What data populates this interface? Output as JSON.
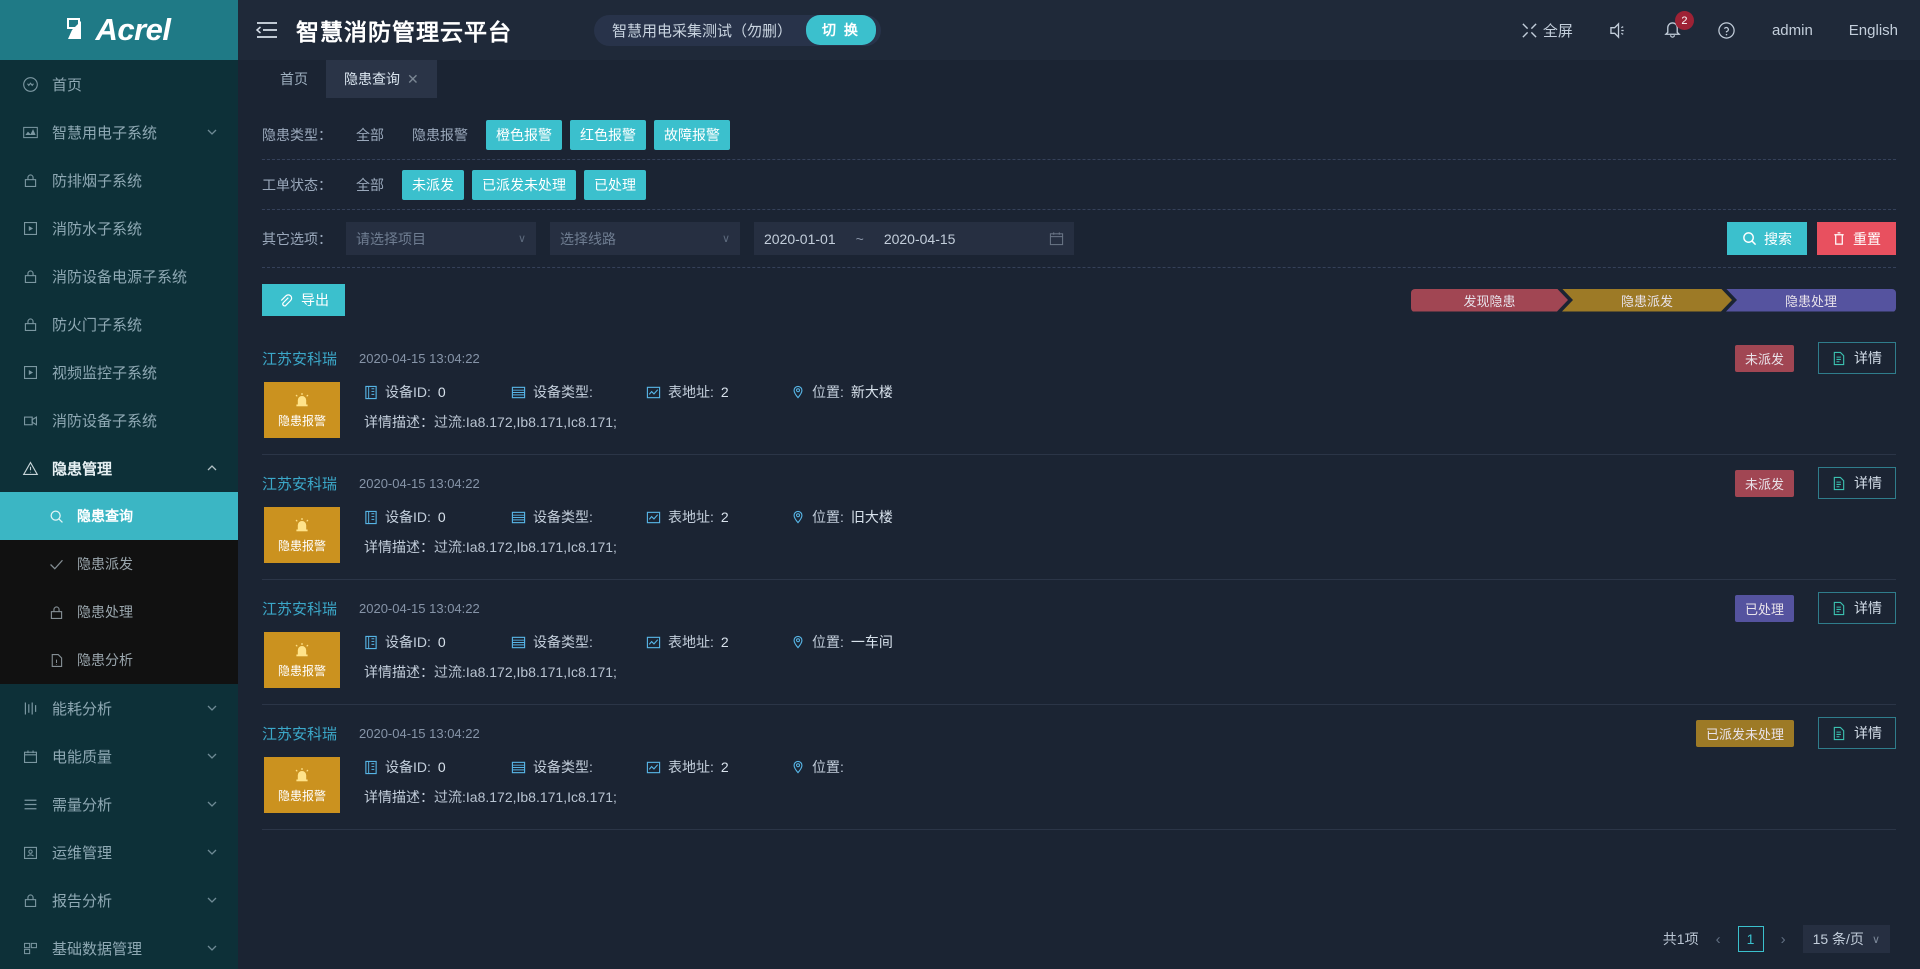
{
  "sidebar": {
    "logo_text": "Acrel",
    "items": [
      {
        "label": "首页",
        "icon": "smiley-icon",
        "has_children": false
      },
      {
        "label": "智慧用电子系统",
        "icon": "chart-bar-icon",
        "has_children": true
      },
      {
        "label": "防排烟子系统",
        "icon": "lock-icon",
        "has_children": false
      },
      {
        "label": "消防水子系统",
        "icon": "play-square-icon",
        "has_children": false
      },
      {
        "label": "消防设备电源子系统",
        "icon": "lock-icon",
        "has_children": false
      },
      {
        "label": "防火门子系统",
        "icon": "lock-icon",
        "has_children": false
      },
      {
        "label": "视频监控子系统",
        "icon": "play-square-icon",
        "has_children": false
      },
      {
        "label": "消防设备子系统",
        "icon": "camera-icon",
        "has_children": false
      },
      {
        "label": "隐患管理",
        "icon": "warning-triangle-icon",
        "has_children": true,
        "expanded": true
      }
    ],
    "sub_items": [
      {
        "label": "隐患查询",
        "icon": "search-icon",
        "active": true
      },
      {
        "label": "隐患派发",
        "icon": "check-icon",
        "active": false
      },
      {
        "label": "隐患处理",
        "icon": "lock-icon",
        "active": false
      },
      {
        "label": "隐患分析",
        "icon": "file-icon",
        "active": false
      }
    ],
    "items_after": [
      {
        "label": "能耗分析",
        "icon": "sliders-icon",
        "has_children": true
      },
      {
        "label": "电能质量",
        "icon": "calendar-icon",
        "has_children": true
      },
      {
        "label": "需量分析",
        "icon": "layers-icon",
        "has_children": true
      },
      {
        "label": "运维管理",
        "icon": "id-card-icon",
        "has_children": true
      },
      {
        "label": "报告分析",
        "icon": "lock-icon",
        "has_children": true
      },
      {
        "label": "基础数据管理",
        "icon": "grid-icon",
        "has_children": true
      }
    ]
  },
  "topbar": {
    "menu_toggle": "menu-fold-icon",
    "title": "智慧消防管理云平台",
    "project_name": "智慧用电采集测试（勿删）",
    "switch_label": "切 换",
    "fullscreen_label": "全屏",
    "notify_count": "2",
    "user": "admin",
    "language": "English"
  },
  "tabs": [
    {
      "label": "首页",
      "closable": false,
      "active": false
    },
    {
      "label": "隐患查询",
      "closable": true,
      "active": true
    }
  ],
  "filters": {
    "type_label": "隐患类型：",
    "type_options": [
      {
        "label": "全部",
        "selected": false
      },
      {
        "label": "隐患报警",
        "selected": false
      },
      {
        "label": "橙色报警",
        "selected": true
      },
      {
        "label": "红色报警",
        "selected": true
      },
      {
        "label": "故障报警",
        "selected": true
      }
    ],
    "status_label": "工单状态：",
    "status_options": [
      {
        "label": "全部",
        "selected": false
      },
      {
        "label": "未派发",
        "selected": true
      },
      {
        "label": "已派发未处理",
        "selected": true
      },
      {
        "label": "已处理",
        "selected": true
      }
    ],
    "other_label": "其它选项：",
    "project_placeholder": "请选择项目",
    "line_placeholder": "选择线路",
    "date_start": "2020-01-01",
    "date_sep": "~",
    "date_end": "2020-04-15",
    "search_label": "搜索",
    "reset_label": "重置"
  },
  "toolbar": {
    "export_label": "导出",
    "legend": [
      {
        "label": "发现隐患",
        "color": "#a14653"
      },
      {
        "label": "隐患派发",
        "color": "#9d7a26"
      },
      {
        "label": "隐患处理",
        "color": "#55539f"
      }
    ]
  },
  "record_labels": {
    "device_id": "设备ID:",
    "device_type": "设备类型:",
    "meter_addr": "表地址:",
    "location": "位置:",
    "description": "详情描述：",
    "detail_button": "详情",
    "alarm_chip": "隐患报警"
  },
  "records": [
    {
      "org": "江苏安科瑞",
      "time": "2020-04-15 13:04:22",
      "status": "未派发",
      "status_class": "s-undispatched",
      "alarm": "隐患报警",
      "device_id": "0",
      "device_type": "",
      "meter_addr": "2",
      "location": "新大楼",
      "description": "过流:Ia8.172,Ib8.171,Ic8.171;"
    },
    {
      "org": "江苏安科瑞",
      "time": "2020-04-15 13:04:22",
      "status": "未派发",
      "status_class": "s-undispatched",
      "alarm": "隐患报警",
      "device_id": "0",
      "device_type": "",
      "meter_addr": "2",
      "location": "旧大楼",
      "description": "过流:Ia8.172,Ib8.171,Ic8.171;"
    },
    {
      "org": "江苏安科瑞",
      "time": "2020-04-15 13:04:22",
      "status": "已处理",
      "status_class": "s-handled",
      "alarm": "隐患报警",
      "device_id": "0",
      "device_type": "",
      "meter_addr": "2",
      "location": "一车间",
      "description": "过流:Ia8.172,Ib8.171,Ic8.171;"
    },
    {
      "org": "江苏安科瑞",
      "time": "2020-04-15 13:04:22",
      "status": "已派发未处理",
      "status_class": "s-dispatched",
      "alarm": "隐患报警",
      "device_id": "0",
      "device_type": "",
      "meter_addr": "2",
      "location": "",
      "description": "过流:Ia8.172,Ib8.171,Ic8.171;"
    }
  ],
  "pagination": {
    "total": "共1项",
    "prev": "‹",
    "page": "1",
    "next": "›",
    "page_size": "15 条/页"
  },
  "colors": {
    "accent": "#3bc0cd",
    "sidebar_bg": "#0d3038",
    "logo_bg": "#1f7a86",
    "page_bg": "#1b2433",
    "danger": "#e8505f",
    "alarm_orange": "#cb921f"
  }
}
